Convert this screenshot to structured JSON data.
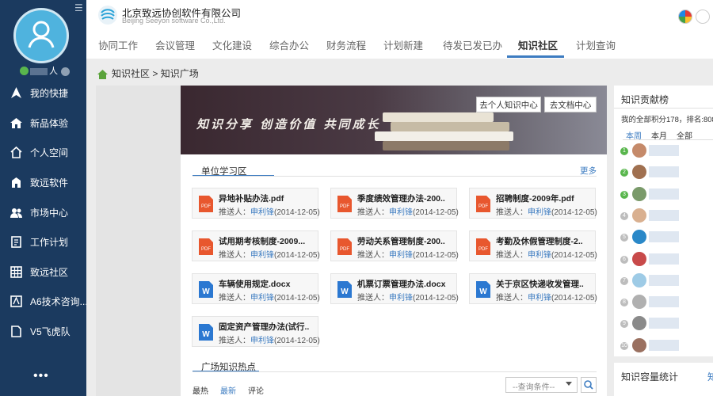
{
  "sidebar": {
    "user_name": "人",
    "items": [
      {
        "label": "我的快捷",
        "icon": "navigate-icon"
      },
      {
        "label": "新品体验",
        "icon": "house-icon"
      },
      {
        "label": "个人空间",
        "icon": "home-outline-icon"
      },
      {
        "label": "致远软件",
        "icon": "building-icon"
      },
      {
        "label": "市场中心",
        "icon": "users-icon"
      },
      {
        "label": "工作计划",
        "icon": "notebook-icon"
      },
      {
        "label": "致远社区",
        "icon": "grid-building-icon"
      },
      {
        "label": "A6技术咨询...",
        "icon": "a6-icon"
      },
      {
        "label": "V5飞虎队",
        "icon": "document-icon"
      }
    ],
    "more": "•••"
  },
  "header": {
    "brand_cn": "北京致远协创软件有限公司",
    "brand_en": "Beijing Seeyon software Co.,Ltd.",
    "tabs": [
      "协同工作",
      "会议管理",
      "文化建设",
      "综合办公",
      "财务流程",
      "计划新建",
      "待发已发已办",
      "知识社区",
      "计划查询"
    ],
    "active_tab": "知识社区"
  },
  "breadcrumb": {
    "root": "知识社区",
    "sep": ">",
    "current": "知识广场"
  },
  "banner": {
    "slogan": "知识分享  创造价值  共同成长",
    "btn_personal": "去个人知识中心",
    "btn_docs": "去文档中心"
  },
  "unit_learning": {
    "title": "单位学习区",
    "more": "更多",
    "meta_label": "推送人：",
    "files": [
      {
        "name": "异地补贴办法.pdf",
        "type": "pdf",
        "pusher": "申利锋",
        "date": "(2014-12-05)"
      },
      {
        "name": "季度绩效管理办法-200..",
        "type": "pdf",
        "pusher": "申利锋",
        "date": "(2014-12-05)"
      },
      {
        "name": "招聘制度-2009年.pdf",
        "type": "pdf",
        "pusher": "申利锋",
        "date": "(2014-12-05)"
      },
      {
        "name": "试用期考核制度-2009...",
        "type": "pdf",
        "pusher": "申利锋",
        "date": "(2014-12-05)"
      },
      {
        "name": "劳动关系管理制度-200..",
        "type": "pdf",
        "pusher": "申利锋",
        "date": "(2014-12-05)"
      },
      {
        "name": "考勤及休假管理制度-2..",
        "type": "pdf",
        "pusher": "申利锋",
        "date": "(2014-12-05)"
      },
      {
        "name": "车辆使用规定.docx",
        "type": "doc",
        "pusher": "申利锋",
        "date": "(2014-12-05)"
      },
      {
        "name": "机票订票管理办法.docx",
        "type": "doc",
        "pusher": "申利锋",
        "date": "(2014-12-05)"
      },
      {
        "name": "关于京区快递收发管理..",
        "type": "doc",
        "pusher": "申利锋",
        "date": "(2014-12-05)"
      },
      {
        "name": "固定资产管理办法(试行..",
        "type": "doc",
        "pusher": "申利锋",
        "date": "(2014-12-05)"
      }
    ]
  },
  "hot": {
    "title": "广场知识热点",
    "tabs": [
      "最热",
      "最新",
      "评论"
    ],
    "active_tab": "最新",
    "query_placeholder": "--查询条件--"
  },
  "contribution": {
    "title": "知识贡献榜",
    "score_text": "我的全部积分178，排名:808",
    "tabs": [
      "本周",
      "本月",
      "全部"
    ],
    "active_tab": "本周",
    "ranks": [
      "1",
      "2",
      "3",
      "4",
      "5",
      "6",
      "7",
      "8",
      "9",
      "10"
    ]
  },
  "capacity": {
    "title": "知识容量统计",
    "link": "知"
  },
  "colors": {
    "sidebar_bg": "#1b3a5f",
    "accent": "#3d7cc1",
    "pdf": "#e8572e",
    "word": "#2b78d1"
  }
}
